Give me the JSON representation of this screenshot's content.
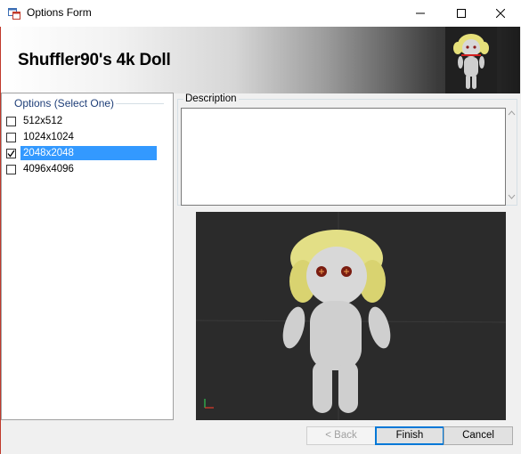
{
  "window": {
    "title": "Options Form",
    "icon": "app-form-icon",
    "controls": [
      "minimize-icon",
      "maximize-icon",
      "close-icon"
    ]
  },
  "banner": {
    "title": "Shuffler90's 4k Doll",
    "thumbnail_icon": "doll-thumbnail"
  },
  "options": {
    "group_title": "Options (Select One)",
    "items": [
      {
        "label": "512x512",
        "checked": false
      },
      {
        "label": "1024x1024",
        "checked": false
      },
      {
        "label": "2048x2048",
        "checked": true
      },
      {
        "label": "4096x4096",
        "checked": false
      }
    ]
  },
  "description": {
    "label": "Description",
    "text": ""
  },
  "preview": {
    "subject": "doll-3d-preview"
  },
  "buttons": {
    "back": "< Back",
    "finish": "Finish",
    "cancel": "Cancel"
  },
  "colors": {
    "selection": "#3399ff",
    "group_title": "#1e3e78",
    "preview_bg": "#2a2a2a"
  }
}
